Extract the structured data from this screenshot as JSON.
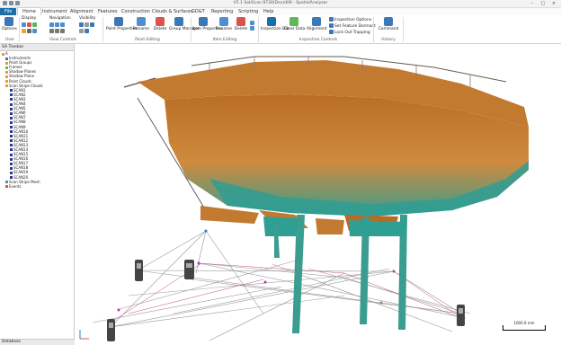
{
  "window": {
    "title": "V5.1 SatiScan 8730(Dev)d09 - SpatialAnalyzer"
  },
  "tabs": [
    "File",
    "Home",
    "Instrument",
    "Alignment",
    "Features",
    "Construction",
    "Clouds & Surfaces",
    "GD&T",
    "Reporting",
    "Scripting",
    "Help"
  ],
  "ribbon": {
    "options": "Options",
    "display": "Display",
    "navigation": "Navigation",
    "visibility": "Visibility",
    "point_properties": "Point Properties",
    "rename": "Rename",
    "delete": "Delete",
    "group_manager": "Group Manager",
    "item_properties": "Item Properties",
    "inspection_bar": "Inspection Bar",
    "clear_data": "Clear Data",
    "alignment": "Alignment",
    "inspection_options": "Inspection Options",
    "set_feature_dormant": "Set Feature Dormant",
    "lock_out_trapping": "Lock Out Trapping",
    "command": "Command",
    "groups": {
      "user": "User",
      "view_controls": "View Controls",
      "point_editing": "Point Editing",
      "item_editing": "Item Editing",
      "inspection_controls": "Inspection Controls",
      "history": "History"
    }
  },
  "sidebar": {
    "title": "SA Treebar",
    "footer": "Database",
    "tree": [
      {
        "label": "A",
        "icon": "folder-icon"
      },
      {
        "label": "Instruments",
        "icon": "instrument-icon"
      },
      {
        "label": "Point Groups",
        "icon": "point-group-icon"
      },
      {
        "label": "Frames",
        "icon": "frame-icon"
      },
      {
        "label": "Shadow Planes",
        "icon": "plane-icon"
      },
      {
        "label": "Shadow Plane",
        "icon": "plane-icon"
      },
      {
        "label": "Point Clouds",
        "icon": "cloud-icon"
      },
      {
        "label": "Scan Stripe Clouds",
        "icon": "cloud-icon"
      },
      {
        "label": "SCAN1",
        "icon": "scan-icon"
      },
      {
        "label": "SCAN2",
        "icon": "scan-icon"
      },
      {
        "label": "SCAN3",
        "icon": "scan-icon"
      },
      {
        "label": "SCAN4",
        "icon": "scan-icon"
      },
      {
        "label": "SCAN5",
        "icon": "scan-icon"
      },
      {
        "label": "SCAN6",
        "icon": "scan-icon"
      },
      {
        "label": "SCAN7",
        "icon": "scan-icon"
      },
      {
        "label": "SCAN8",
        "icon": "scan-icon"
      },
      {
        "label": "SCAN9",
        "icon": "scan-icon"
      },
      {
        "label": "SCAN10",
        "icon": "scan-icon"
      },
      {
        "label": "SCAN11",
        "icon": "scan-icon"
      },
      {
        "label": "SCAN12",
        "icon": "scan-icon"
      },
      {
        "label": "SCAN13",
        "icon": "scan-icon"
      },
      {
        "label": "SCAN14",
        "icon": "scan-icon"
      },
      {
        "label": "SCAN15",
        "icon": "scan-icon"
      },
      {
        "label": "SCAN16",
        "icon": "scan-icon"
      },
      {
        "label": "SCAN17",
        "icon": "scan-icon"
      },
      {
        "label": "SCAN18",
        "icon": "scan-icon"
      },
      {
        "label": "SCAN19",
        "icon": "scan-icon"
      },
      {
        "label": "SCAN20",
        "icon": "scan-icon"
      },
      {
        "label": "Scan Stripe Mesh",
        "icon": "mesh-icon"
      },
      {
        "label": "Events",
        "icon": "events-icon"
      }
    ]
  },
  "viewport": {
    "scale_label": "1000.0 mm"
  },
  "colors": {
    "hull": "#c47a2c",
    "bottom": "#2f9e93",
    "file_tab": "#1c6ea8",
    "lines": "#9a9a9a"
  }
}
